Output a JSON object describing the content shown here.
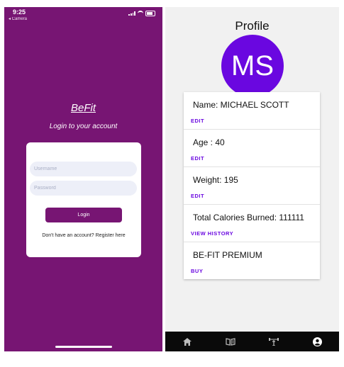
{
  "login": {
    "status_time": "9:25",
    "status_back": "◂ Camera",
    "app_name": "BeFit",
    "subtitle": "Login to  your account",
    "username_placeholder": "Username",
    "password_placeholder": "Password",
    "login_label": "Login",
    "register_text": "Don't have an account? Register here"
  },
  "profile": {
    "title": "Profile",
    "avatar_initials": "MS",
    "items": [
      {
        "label": "Name: MICHAEL SCOTT",
        "action": "EDIT"
      },
      {
        "label": "Age : 40",
        "action": "EDIT"
      },
      {
        "label": "Weight: 195",
        "action": "EDIT"
      },
      {
        "label": "Total Calories Burned: 111111",
        "action": "VIEW HISTORY"
      },
      {
        "label": "BE-FIT PREMIUM",
        "action": "BUY"
      }
    ]
  },
  "tabbar": {
    "icons": [
      "home-icon",
      "book-icon",
      "dumbbell-icon",
      "account-icon"
    ],
    "active_color": "#ffffff",
    "inactive_color": "#bdbdbd"
  },
  "colors": {
    "login_bg": "#771573",
    "accent": "#6a07e0",
    "field_bg": "#edeff8"
  }
}
